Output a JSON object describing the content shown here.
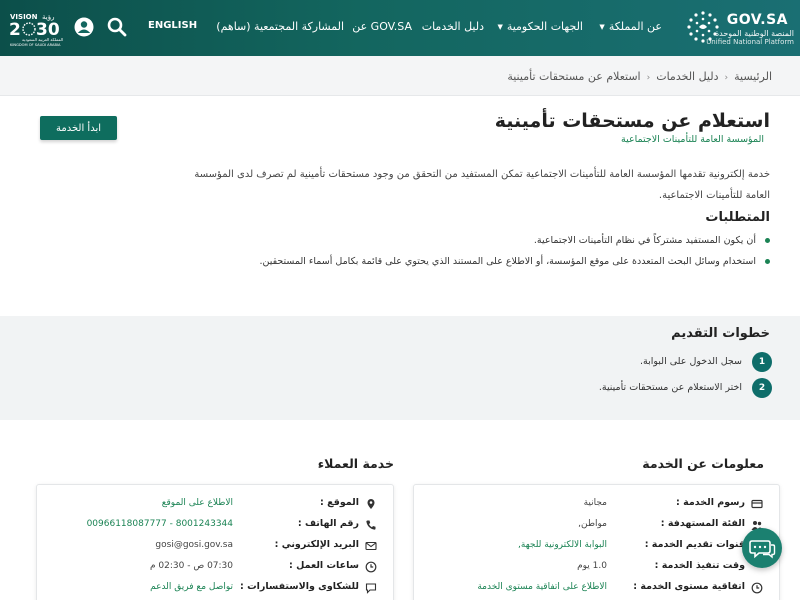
{
  "header": {
    "brand": {
      "name": "GOV.SA",
      "ar_line": "المنصة الوطنية الموحدة",
      "en_line": "Unified National Platform"
    },
    "nav": {
      "kingdom": "عن المملكة",
      "gov_entities": "الجهات الحكومية",
      "service_guide": "دليل الخدمات",
      "about_govsa": "عن GOV.SA",
      "sahem": "المشاركة المجتمعية (ساهم)",
      "english": "ENGLISH"
    },
    "vision": {
      "line1": "VISION",
      "year": "2030",
      "ar": "رؤية",
      "sub": "المملكة العربية السعودية",
      "en_sub": "KINGDOM OF SAUDI ARABIA"
    }
  },
  "breadcrumb": {
    "home": "الرئيسية",
    "guide": "دليل الخدمات",
    "current": "استعلام عن مستحقات تأمينية"
  },
  "service": {
    "title": "استعلام عن مستحقات تأمينية",
    "agency": "المؤسسة العامة للتأمينات الاجتماعية",
    "start_button": "ابدأ الخدمة",
    "description": "خدمة إلكترونية تقدمها المؤسسة العامة للتأمينات الاجتماعية تمكن المستفيد من التحقق من وجود مستحقات تأمينية لم تصرف لدى المؤسسة العامة للتأمينات الاجتماعية.",
    "requirements_title": "المتطلبات",
    "requirements": [
      "أن يكون المستفيد مشتركاً في نظام التأمينات الاجتماعية.",
      "استخدام  وسائل البحث المتعددة على موقع المؤسسة، أو الاطلاع على المستند الذي يحتوي على قائمة بكامل أسماء المستحقين."
    ]
  },
  "steps": {
    "title": "خطوات التقديم",
    "items": [
      {
        "num": "1",
        "text": "سجل الدخول على البوابة."
      },
      {
        "num": "2",
        "text": "اختر الاستعلام عن مستحقات تأمينية."
      }
    ]
  },
  "service_info": {
    "title": "معلومات عن الخدمة",
    "rows": [
      {
        "icon": "card-icon",
        "label": "رسوم الخدمة :",
        "value": "مجانية"
      },
      {
        "icon": "users-icon",
        "label": "الفئة المستهدفة :",
        "value": "مواطن,"
      },
      {
        "icon": "channels-icon",
        "label": "قنوات تقديم الخدمة :",
        "value": "البوابة الالكترونية للجهة,"
      },
      {
        "icon": "clock-icon",
        "label": "وقت تنفيذ الخدمة :",
        "value": "1.0 يوم"
      },
      {
        "icon": "agreement-icon",
        "label": "اتفاقية مستوى الخدمة :",
        "value": "الاطلاع على اتفاقية مستوى الخدمة"
      }
    ]
  },
  "customer_service": {
    "title": "خدمة العملاء",
    "rows": [
      {
        "icon": "location-icon",
        "label": "الموقع :",
        "value": "الاطلاع على الموقع"
      },
      {
        "icon": "phone-icon",
        "label": "رقم الهاتف :",
        "value": "8001243344 - 00966118087777"
      },
      {
        "icon": "mail-icon",
        "label": "البريد الإلكتروني :",
        "value": "gosi@gosi.gov.sa"
      },
      {
        "icon": "clock-icon",
        "label": "ساعات العمل :",
        "value": "07:30 ص - 02:30 م"
      },
      {
        "icon": "complaint-icon",
        "label": "للشكاوى والاستفسارات :",
        "value": "تواصل مع فريق الدعم"
      }
    ]
  },
  "colors": {
    "header": "#0e5c56",
    "accent": "#1b8354",
    "button": "#0e6d5e",
    "step": "#0e6d6a"
  }
}
